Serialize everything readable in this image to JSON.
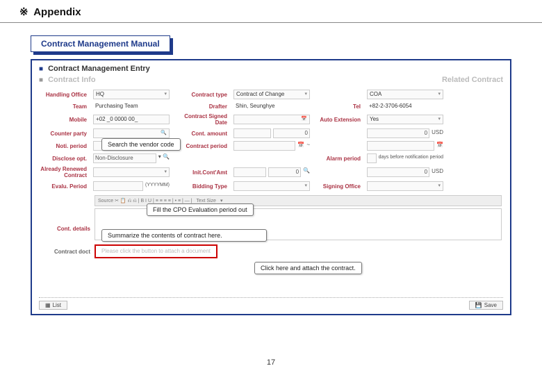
{
  "page": {
    "appendix_symbol": "※",
    "appendix_label": "Appendix",
    "number": "17"
  },
  "tab": {
    "label": "Contract Management Manual"
  },
  "section": {
    "contract_info": "Contract Info",
    "entry_title": "Contract Management Entry",
    "related_contract": "Related Contract"
  },
  "labels": {
    "handling_office": "Handling Office",
    "contract_type": "Contract type",
    "coa": "COA",
    "team": "Team",
    "drafter": "Drafter",
    "tel": "Tel",
    "mobile": "Mobile",
    "signed_date": "Contract Signed Date",
    "auto_extension": "Auto Extension",
    "counter_party": "Counter party",
    "cont_amount": "Cont. amount",
    "noti_period": "Noti. period",
    "contract_period": "Contract period",
    "disclose_opt": "Disclose opt.",
    "alarm_period": "Alarm period",
    "already_renewed": "Already Renewed Contract",
    "init_cont_amt": "Init.Cont'Amt",
    "eval_period": "Evalu. Period",
    "bidding_type": "Bidding Type",
    "signing_office": "Signing Office",
    "cont_details": "Cont. details",
    "cont_doc": "Contract doct"
  },
  "values": {
    "handling_office": "HQ",
    "contract_type": "Contract of Change",
    "coa": "COA",
    "team": "Purchasing Team",
    "drafter": "Shin, Seunghye",
    "tel": "+82-2-3706-6054",
    "mobile": "+02 _0 0000 00_",
    "auto_extension": "Yes",
    "usd_suffix": "USD",
    "tilde": "~",
    "zero": "0",
    "disclose": "Non-Disclosure",
    "alarm_tail": "days before notification period",
    "text_size": "Text Size",
    "yymm": "(YYYYMM)",
    "attach_placeholder": "Please  click the   button to  attach a  document"
  },
  "callouts": {
    "search_vendor": "Search the vendor code",
    "fill_cpo": "Fill the CPO Evaluation period out",
    "summarize": "Summarize the contents of contract here.",
    "attach": "Click here and attach the contract."
  },
  "buttons": {
    "list": "List",
    "save": "Save"
  }
}
